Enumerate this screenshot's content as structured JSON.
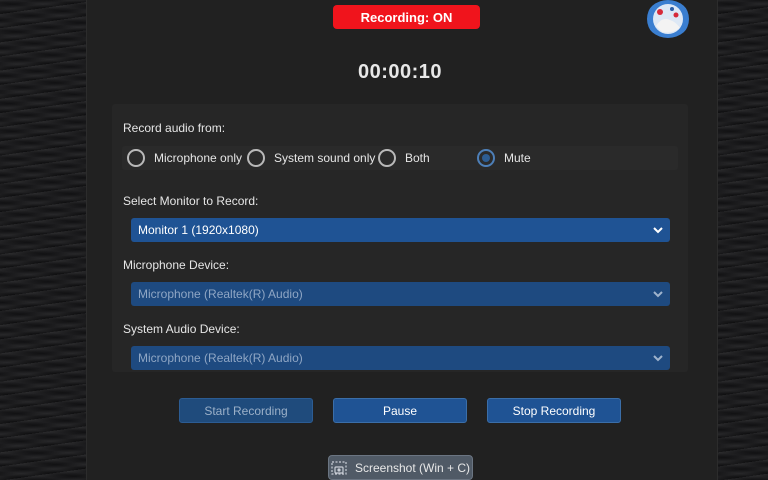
{
  "status": {
    "recording_label": "Recording: ON"
  },
  "timer": {
    "elapsed": "00:00:10"
  },
  "audio": {
    "heading": "Record audio from:",
    "options": [
      "Microphone only",
      "System sound only",
      "Both",
      "Mute"
    ],
    "selected": "Mute"
  },
  "monitor": {
    "label": "Select Monitor to Record:",
    "value": "Monitor 1 (1920x1080)"
  },
  "microphone": {
    "label": "Microphone Device:",
    "value": "Microphone (Realtek(R) Audio)",
    "enabled": false
  },
  "system_audio": {
    "label": "System Audio Device:",
    "value": "Microphone (Realtek(R) Audio)",
    "enabled": false
  },
  "buttons": {
    "start": "Start Recording",
    "pause": "Pause",
    "stop": "Stop Recording",
    "screenshot": "Screenshot (Win + C)"
  },
  "colors": {
    "accent": "#1f5394",
    "recording": "#f0141c",
    "window_bg": "#212121"
  },
  "icons": {
    "avatar": "user-avatar-icon",
    "chevron": "chevron-down-icon",
    "camera": "camera-icon"
  }
}
